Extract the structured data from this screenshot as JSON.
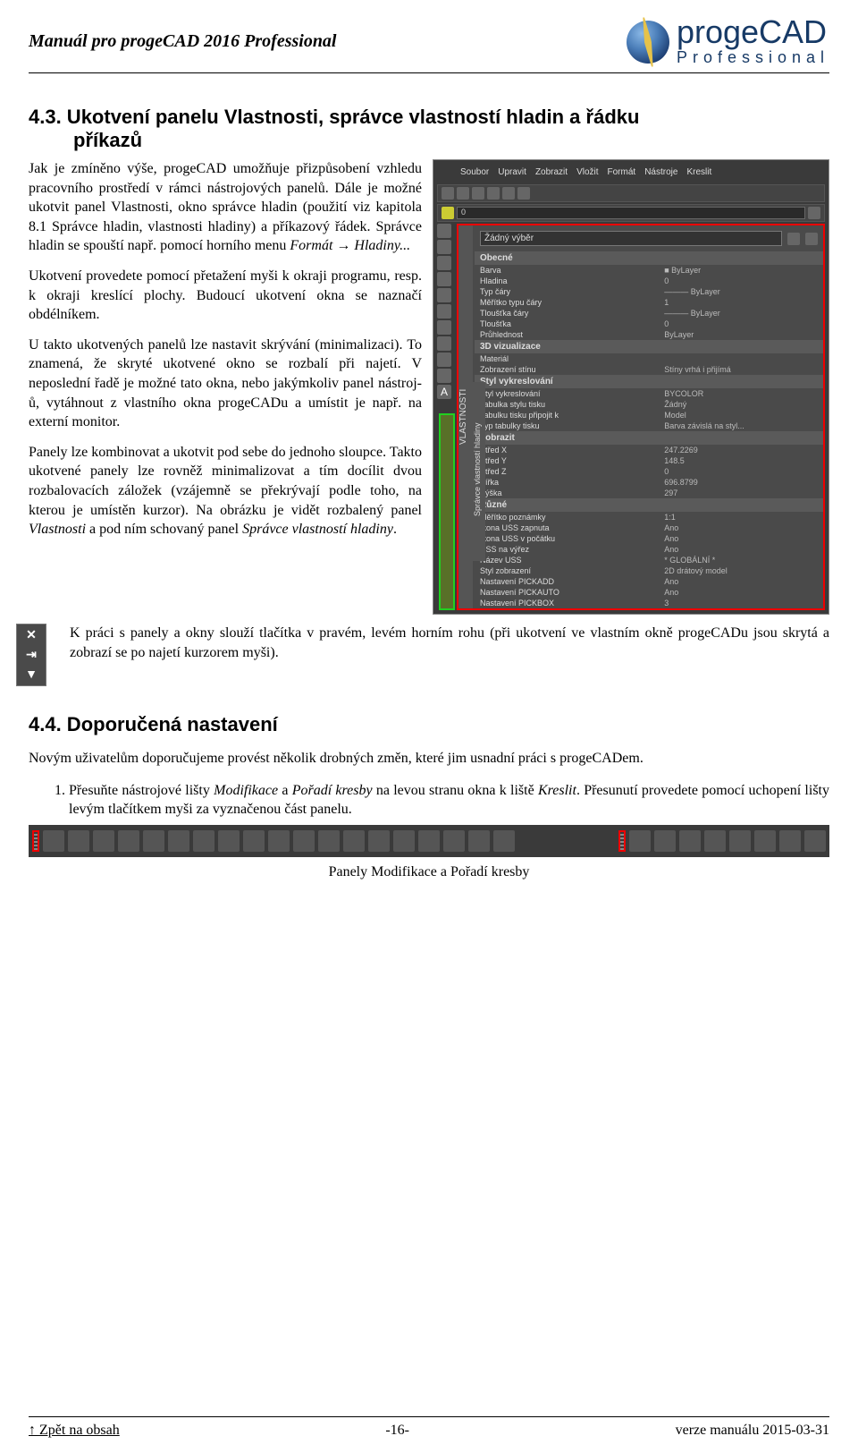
{
  "header": {
    "title": "Manuál pro progeCAD 2016 Professional",
    "logo_main": "progeCAD",
    "logo_sub": "Professional"
  },
  "section43": {
    "heading_line1": "4.3. Ukotvení panelu Vlastnosti, správce vlastností hladin a řádku",
    "heading_line2": "příkazů",
    "p1": "Jak je zmíněno výše, progeCAD umožňuje přizpůsobení vzhledu pracovního prostředí v rámci nástrojových panelů. Dále je možné ukotvit panel Vlastnosti, okno správce hladin (použití viz kapitola 8.1 Správce hladin, vlastnosti hladiny) a příkazový řádek. Správce hladin se spouští např. pomocí horního menu ",
    "p1_italic1": "Formát → Hladiny...",
    "p2": "Ukotvení provedete pomocí přetažení myši k okraji programu, resp. k okraji kreslící plochy. Budoucí ukotvení okna se naznačí obdélníkem.",
    "p3": "U takto ukotvených panelů lze nastavit skrývání (minimalizaci). To znamená, že skryté ukotvené okno se rozbalí při najetí. V neposlední řadě je možné tato okna, nebo jakýmkoliv panel nástroj­ů, vytáhnout z vlastního okna progeCADu a umístit je např. na externí monitor.",
    "p4a": "Panely lze kombinovat a ukotvit pod sebe do jednoho sloupce. Takto ukotvené panely lze rovněž minimalizovat a tím docílit dvou rozbalovacích záložek (vzájemně se překrývají podle toho, na kterou je umístěn kurzor). Na obrázku je vidět rozbalený panel ",
    "p4_italic1": "Vlastnosti",
    "p4b": " a pod ním schovaný panel ",
    "p4_italic2": "Správce vlastností hladiny",
    "p4c": ".",
    "p5": "K práci s panely a okny slouží tlačítka v pravém, levém horním rohu (při ukotvení ve vlastním okně progeCADu jsou skrytá a zobrazí se po najetí kurzorem myši)."
  },
  "screenshot": {
    "menubar": [
      "Soubor",
      "Upravit",
      "Zobrazit",
      "Vložit",
      "Formát",
      "Nástroje",
      "Kreslit"
    ],
    "selector_label": "Žádný výběr",
    "handle_vlastnosti": "VLASTNOSTI",
    "handle_spravce": "Správce vlastností hladiny",
    "sections": [
      {
        "title": "Obecné",
        "rows": [
          [
            "Barva",
            "■ ByLayer"
          ],
          [
            "Hladina",
            "0"
          ],
          [
            "Typ čáry",
            "——— ByLayer"
          ],
          [
            "Měřítko typu čáry",
            "1"
          ],
          [
            "Tloušťka čáry",
            "——— ByLayer"
          ],
          [
            "Tloušťka",
            "0"
          ],
          [
            "Průhlednost",
            "ByLayer"
          ]
        ]
      },
      {
        "title": "3D vizualizace",
        "rows": [
          [
            "Materiál",
            ""
          ],
          [
            "Zobrazení stínu",
            "Stíny vrhá i přijímá"
          ]
        ]
      },
      {
        "title": "Styl vykreslování",
        "rows": [
          [
            "Styl vykreslování",
            "BYCOLOR"
          ],
          [
            "Tabulka stylu tisku",
            "Žádný"
          ],
          [
            "Tabulku tisku připojit k",
            "Model"
          ],
          [
            "Typ tabulky tisku",
            "Barva závislá na styl..."
          ]
        ]
      },
      {
        "title": "Zobrazit",
        "rows": [
          [
            "Střed X",
            "247.2269"
          ],
          [
            "Střed Y",
            "148.5"
          ],
          [
            "Střed Z",
            "0"
          ],
          [
            "Šířka",
            "696.8799"
          ],
          [
            "Výška",
            "297"
          ]
        ]
      },
      {
        "title": "Různé",
        "rows": [
          [
            "Měřítko poznámky",
            "1:1"
          ],
          [
            "Ikona USS zapnuta",
            "Ano"
          ],
          [
            "Ikona USS v počátku",
            "Ano"
          ],
          [
            "USS na výřez",
            "Ano"
          ],
          [
            "Název USS",
            "* GLOBÁLNÍ *"
          ],
          [
            "Styl zobrazení",
            "2D drátový model"
          ],
          [
            "Nastavení PICKADD",
            "Ano"
          ],
          [
            "Nastavení PICKAUTO",
            "Ano"
          ],
          [
            "Nastavení PICKBOX",
            "3"
          ]
        ]
      }
    ],
    "mini_icons": [
      "✕",
      "⇥",
      "▼"
    ]
  },
  "section44": {
    "heading": "4.4. Doporučená nastavení",
    "p1": "Novým uživatelům doporučujeme provést několik drobných změn, které jim usnadní práci s progeCADem.",
    "li1a": "Přesuňte nástrojové lišty ",
    "li1_italic1": "Modifikace",
    "li1b": " a ",
    "li1_italic2": "Pořadí kresby",
    "li1c": " na levou stranu okna k liště ",
    "li1_italic3": "Kreslit",
    "li1d": ". Přesunutí provedete pomocí uchopení lišty levým tlačítkem myši za vyznačenou část panelu.",
    "caption": "Panely Modifikace a Pořadí kresby"
  },
  "footer": {
    "left": "↑ Zpět na obsah",
    "center": "-16-",
    "right": "verze manuálu 2015-03-31"
  }
}
